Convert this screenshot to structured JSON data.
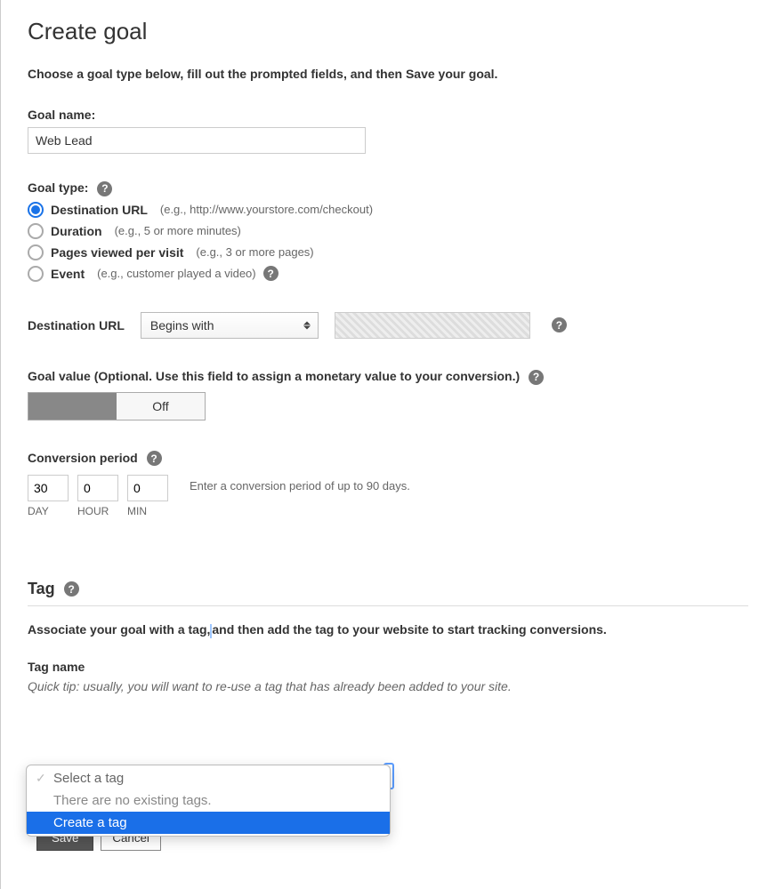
{
  "title": "Create goal",
  "intro": "Choose a goal type below, fill out the prompted fields, and then Save your goal.",
  "goal_name": {
    "label": "Goal name:",
    "value": "Web Lead"
  },
  "goal_type": {
    "label": "Goal type:",
    "options": [
      {
        "label": "Destination URL",
        "hint": "(e.g., http://www.yourstore.com/checkout)",
        "selected": true
      },
      {
        "label": "Duration",
        "hint": "(e.g., 5 or more minutes)",
        "selected": false
      },
      {
        "label": "Pages viewed per visit",
        "hint": "(e.g., 3 or more pages)",
        "selected": false
      },
      {
        "label": "Event",
        "hint": "(e.g., customer played a video)",
        "selected": false,
        "extra_help": true
      }
    ]
  },
  "destination": {
    "label": "Destination URL",
    "match_mode": "Begins with",
    "url_value": ""
  },
  "goal_value": {
    "label": "Goal value (Optional. Use this field to assign a monetary value to your conversion.)",
    "state": "Off"
  },
  "conversion_period": {
    "label": "Conversion period",
    "hint": "Enter a conversion period of up to 90 days.",
    "day": {
      "value": "30",
      "unit": "DAY"
    },
    "hour": {
      "value": "0",
      "unit": "HOUR"
    },
    "min": {
      "value": "0",
      "unit": "MIN"
    }
  },
  "tag": {
    "heading": "Tag",
    "desc_a": "Associate your goal with a tag,",
    "desc_b": "and then add the tag to your website to start tracking conversions.",
    "name_label": "Tag name",
    "tip": "Quick tip: usually, you will want to re-use a tag that has already been added to your site.",
    "dropdown": {
      "placeholder": "Select a tag",
      "empty_msg": "There are no existing tags.",
      "create_label": "Create a tag"
    }
  },
  "buttons": {
    "save": "Save",
    "cancel": "Cancel"
  },
  "help_glyph": "?"
}
